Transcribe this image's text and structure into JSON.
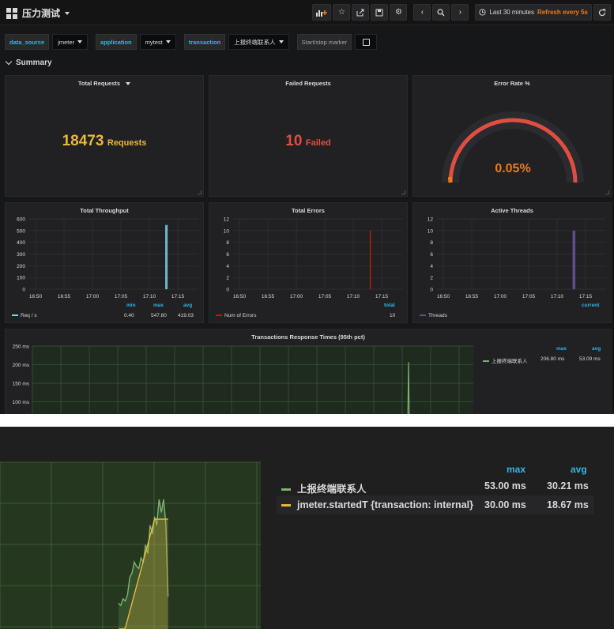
{
  "nav": {
    "title": "压力测试",
    "time_range": "Last 30 minutes",
    "refresh": "Refresh every 5s",
    "icons": [
      "add-panel-icon",
      "star-icon",
      "share-icon",
      "save-icon",
      "gear-icon",
      "chevron-left-icon",
      "zoom-out-icon",
      "chevron-right-icon",
      "clock-icon",
      "refresh-icon"
    ]
  },
  "variables": [
    {
      "label": "data_source",
      "value": "jmeter"
    },
    {
      "label": "application",
      "value": "mytest"
    },
    {
      "label": "transaction",
      "value": "上报终端联系人"
    }
  ],
  "marker": {
    "label": "Start/stop marker"
  },
  "row": {
    "title": "Summary"
  },
  "colors": {
    "accent": "#33b5e5",
    "yellow": "#eab839",
    "red": "#e24d42",
    "orange": "#eb7b18",
    "green": "#7eb26d",
    "blue": "#70dbed",
    "purple": "#614d93"
  },
  "stats": {
    "total_requests": {
      "title": "Total Requests",
      "value": "18473",
      "unit": "Requests"
    },
    "failed_requests": {
      "title": "Failed Requests",
      "value": "10",
      "unit": "Failed"
    },
    "error_rate": {
      "title": "Error Rate %",
      "value": "0.05%",
      "gauge_fraction": 0.0005
    }
  },
  "chart_data": [
    {
      "type": "line",
      "title": "Total Throughput",
      "ylim": [
        0,
        600
      ],
      "y_ticks": [
        "600",
        "500",
        "400",
        "300",
        "200",
        "100",
        "0"
      ],
      "x_ticks": [
        "16:50",
        "16:55",
        "17:00",
        "17:05",
        "17:10",
        "17:15"
      ],
      "series": [
        {
          "name": "Req / s",
          "points": [
            [
              "17:13",
              0
            ],
            [
              "17:13",
              547.8
            ],
            [
              "17:14",
              0
            ]
          ]
        }
      ],
      "legend": {
        "headers": [
          "min",
          "max",
          "avg"
        ],
        "rows": [
          {
            "name": "Req / s",
            "values": [
              "0.40",
              "547.80",
              "419.03"
            ]
          }
        ]
      }
    },
    {
      "type": "line",
      "title": "Total Errors",
      "ylim": [
        0,
        12
      ],
      "y_ticks": [
        "12",
        "10",
        "8",
        "6",
        "4",
        "2",
        "0"
      ],
      "x_ticks": [
        "16:50",
        "16:55",
        "17:00",
        "17:05",
        "17:10",
        "17:15"
      ],
      "series": [
        {
          "name": "Num of Errors",
          "points": [
            [
              "17:13",
              0
            ],
            [
              "17:13",
              10
            ]
          ]
        }
      ],
      "legend": {
        "headers": [
          "total"
        ],
        "rows": [
          {
            "name": "Num of Errors",
            "values": [
              "10"
            ]
          }
        ]
      }
    },
    {
      "type": "line",
      "title": "Active Threads",
      "ylim": [
        0,
        12
      ],
      "y_ticks": [
        "12",
        "10",
        "8",
        "6",
        "4",
        "2",
        "0"
      ],
      "x_ticks": [
        "16:50",
        "16:55",
        "17:00",
        "17:05",
        "17:10",
        "17:15"
      ],
      "series": [
        {
          "name": "Threads",
          "points": [
            [
              "17:13",
              0
            ],
            [
              "17:13",
              10
            ]
          ]
        }
      ],
      "legend": {
        "headers": [
          "current"
        ],
        "rows": [
          {
            "name": "Threads",
            "values": [
              ""
            ]
          }
        ]
      }
    },
    {
      "type": "line",
      "title": "Transactions Response Times (95th pct)",
      "y_ticks": [
        "250 ms",
        "200 ms",
        "150 ms",
        "100 ms"
      ],
      "series": [
        {
          "name": "上报终端联系人",
          "spike_ms": 206.8
        }
      ],
      "legend": {
        "headers": [
          "max",
          "avg"
        ],
        "rows": [
          {
            "name": "上报终端联系人",
            "values": [
              "206.80 ms",
              "53.09 ms"
            ]
          }
        ]
      }
    },
    {
      "type": "area",
      "title": "",
      "series": [
        {
          "name": "上报终端联系人",
          "values": [
            5,
            4,
            7,
            6,
            9,
            17,
            19,
            24,
            22,
            21,
            26,
            24,
            32,
            28,
            41,
            37,
            45,
            41,
            53,
            47,
            53,
            42,
            8
          ]
        },
        {
          "name": "jmeter.startedT {transaction: internal}",
          "values": [
            0,
            0,
            2,
            4,
            6,
            8,
            10,
            12,
            14,
            16,
            18,
            20,
            22,
            24,
            26,
            28,
            30,
            30,
            30,
            30,
            30,
            30,
            30
          ]
        }
      ],
      "legend": {
        "headers": [
          "max",
          "avg"
        ],
        "rows": [
          {
            "name": "上报终端联系人",
            "values": [
              "53.00 ms",
              "30.21 ms"
            ]
          },
          {
            "name": "jmeter.startedT {transaction: internal}",
            "values": [
              "30.00 ms",
              "18.67 ms"
            ]
          }
        ]
      }
    }
  ]
}
